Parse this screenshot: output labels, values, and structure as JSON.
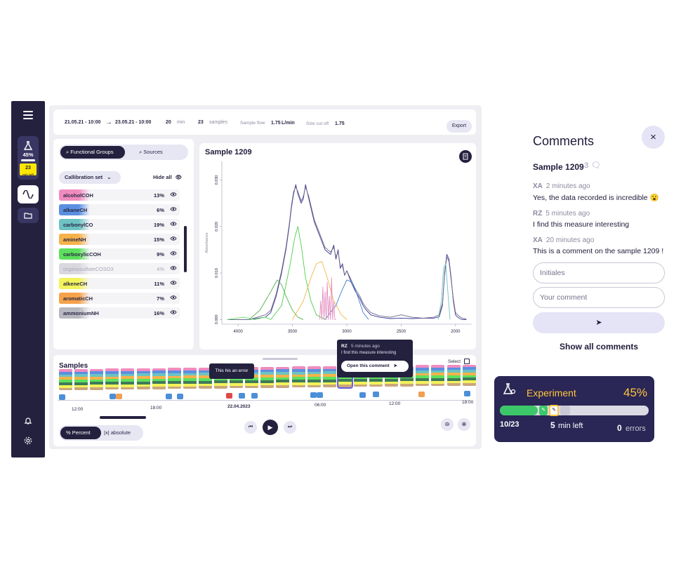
{
  "sidebar": {
    "menu_icon": "hamburger-icon",
    "experiment_percent": "45%",
    "mini_badge": "23",
    "mini_sub": "min left",
    "colors": {
      "bg": "#24213f",
      "accent": "#ffe600"
    }
  },
  "topbar": {
    "date_from": "21.05.21 - 10:00",
    "date_to": "23.05.21 - 10:00",
    "duration_value": "20",
    "duration_unit": "min",
    "samples_value": "23",
    "samples_label": "samples",
    "flow_label": "Sample flow",
    "flow_value": "1.75",
    "flow_unit": "L/min",
    "cutoff_label": "Size cut off",
    "cutoff_value": "1.75",
    "export_label": "Export"
  },
  "groups_panel": {
    "tab_functional": "Functional Groups",
    "tab_sources": "Sources",
    "calibration_label": "Callibration set",
    "hide_all_label": "Hide all",
    "items": [
      {
        "label": "alcoholCOH",
        "percent": "13%",
        "color": "#f08bbf"
      },
      {
        "label": "alkaneCH",
        "percent": "6%",
        "color": "#5b8fe0"
      },
      {
        "label": "carbonylCO",
        "percent": "19%",
        "color": "#6cc3c2"
      },
      {
        "label": "amineNH",
        "percent": "15%",
        "color": "#f6b24a"
      },
      {
        "label": "carboxylicCOH",
        "percent": "9%",
        "color": "#5de05d"
      },
      {
        "label": "organosulfateCOSO3",
        "percent": "4%",
        "color": "#d8d8de"
      },
      {
        "label": "alkeneCH",
        "percent": "11%",
        "color": "#f3f35a"
      },
      {
        "label": "aromaticCH",
        "percent": "7%",
        "color": "#f5a24a"
      },
      {
        "label": "ammoniumNH",
        "percent": "16%",
        "color": "#b8b8c0"
      }
    ]
  },
  "spectrum": {
    "title": "Sample 1209",
    "ylabel": "Absorbance"
  },
  "chart_data": {
    "type": "line",
    "title": "Sample 1209",
    "xlabel": "",
    "ylabel": "Absorbance",
    "x_ticks": [
      "4000",
      "3500",
      "3000",
      "2500",
      "2000"
    ],
    "y_ticks": [
      "0.000",
      "0.010",
      "0.020",
      "0.030"
    ],
    "xlim": [
      4150,
      1850
    ],
    "ylim": [
      -0.001,
      0.034
    ],
    "series": [
      {
        "color": "#3b3a8f",
        "x": [
          4100,
          3900,
          3750,
          3700,
          3650,
          3600,
          3560,
          3530,
          3510,
          3490,
          3470,
          3450,
          3420,
          3400,
          3380,
          3350,
          3300,
          3250,
          3200,
          3150,
          3120,
          3100,
          3080,
          3060,
          3040,
          3020,
          3000,
          2960,
          2920,
          2880,
          2850,
          2820,
          2780,
          2700,
          2600,
          2500,
          2400,
          2300,
          2200,
          2150,
          2120,
          2100,
          2080,
          2060,
          2040,
          2020,
          2000,
          1980,
          1960,
          1940,
          1920,
          1900
        ],
        "y": [
          0.0,
          0.0,
          0.0005,
          0.0015,
          0.005,
          0.01,
          0.015,
          0.02,
          0.024,
          0.027,
          0.029,
          0.027,
          0.025,
          0.026,
          0.029,
          0.026,
          0.021,
          0.018,
          0.015,
          0.014,
          0.016,
          0.013,
          0.015,
          0.011,
          0.012,
          0.0095,
          0.0105,
          0.008,
          0.006,
          0.0045,
          0.003,
          0.002,
          0.001,
          0.0005,
          0.0002,
          0.0003,
          0.0002,
          0.0003,
          0.0003,
          0.0006,
          0.003,
          0.01,
          0.014,
          0.013,
          0.009,
          0.004,
          0.001,
          0.0005,
          0.0002,
          0.0,
          0.0,
          0.0
        ]
      },
      {
        "color": "#6e6a8c",
        "x": [
          4100,
          3900,
          3750,
          3700,
          3650,
          3600,
          3560,
          3530,
          3510,
          3490,
          3470,
          3450,
          3420,
          3400,
          3380,
          3350,
          3300,
          3250,
          3200,
          3150,
          3120,
          3100,
          3080,
          3060,
          3040,
          3020,
          3000,
          2960,
          2920,
          2880,
          2850,
          2820,
          2780,
          2700,
          2600,
          2500,
          2400,
          2300,
          2200,
          2150,
          2120,
          2100,
          2080,
          2060,
          2040,
          2020,
          2000,
          1980,
          1960,
          1940,
          1920,
          1900
        ],
        "y": [
          0.0,
          0.0,
          0.001,
          0.002,
          0.0055,
          0.0105,
          0.0155,
          0.0205,
          0.0245,
          0.0275,
          0.0285,
          0.0275,
          0.0255,
          0.0265,
          0.0285,
          0.0265,
          0.0215,
          0.0185,
          0.0155,
          0.0145,
          0.0155,
          0.0135,
          0.0145,
          0.0115,
          0.0115,
          0.0095,
          0.0105,
          0.0085,
          0.0065,
          0.005,
          0.0035,
          0.0025,
          0.0015,
          0.0008,
          0.0005,
          0.001,
          0.0005,
          0.0003,
          0.0005,
          0.001,
          0.0035,
          0.0095,
          0.0135,
          0.0125,
          0.0085,
          0.0045,
          0.0015,
          0.001,
          0.0006,
          0.0003,
          0.0002,
          0.0001
        ]
      },
      {
        "color": "#4ad04a",
        "x": [
          3700,
          3600,
          3520,
          3480,
          3450,
          3420,
          3380,
          3330,
          3280,
          3200
        ],
        "y": [
          0.0,
          0.003,
          0.012,
          0.0175,
          0.02,
          0.016,
          0.009,
          0.004,
          0.001,
          0.0
        ]
      },
      {
        "color": "#56b24f",
        "x": [
          3900,
          3800,
          3700,
          3640,
          3600,
          3560,
          3500,
          3450,
          3400
        ],
        "y": [
          0.0,
          0.002,
          0.006,
          0.0085,
          0.0075,
          0.005,
          0.002,
          0.0005,
          0.0
        ]
      },
      {
        "color": "#f2b94a",
        "x": [
          3500,
          3400,
          3330,
          3280,
          3230,
          3180,
          3120,
          3050,
          3000
        ],
        "y": [
          0.0,
          0.004,
          0.009,
          0.012,
          0.0125,
          0.009,
          0.004,
          0.001,
          0.0
        ]
      },
      {
        "color": "#3f7fd0",
        "x": [
          3200,
          3100,
          3050,
          3000,
          2950,
          2900,
          2850,
          2800
        ],
        "y": [
          0.0,
          0.003,
          0.006,
          0.0085,
          0.008,
          0.005,
          0.0015,
          0.0
        ]
      },
      {
        "color": "#e48fc0",
        "x": [
          3250,
          3240,
          3230,
          3220,
          3210,
          3200,
          3190,
          3180,
          3170,
          3160,
          3150,
          3140,
          3130,
          3120,
          3110,
          3100
        ],
        "y": [
          0.0,
          0.004,
          0.0,
          0.007,
          0.0,
          0.006,
          0.0,
          0.008,
          0.0,
          0.005,
          0.0,
          0.009,
          0.0,
          0.004,
          0.0,
          0.0
        ]
      },
      {
        "color": "#6cc3c2",
        "x": [
          2160,
          2130,
          2110,
          2090,
          2070,
          2050
        ],
        "y": [
          0.0,
          0.004,
          0.011,
          0.012,
          0.006,
          0.0
        ]
      },
      {
        "color": "#5de05d",
        "x": [
          4100,
          3950,
          3850,
          3750,
          3700
        ],
        "y": [
          0.0,
          0.0005,
          0.0,
          0.0005,
          0.0
        ]
      }
    ]
  },
  "samples": {
    "title": "Samples",
    "select_label": "Select",
    "error_tooltip": "This his an error",
    "comment_author": "RZ",
    "comment_time": "5 minutes ago",
    "comment_text": "I find this measure interesting",
    "open_comment_label": "Open this comment",
    "time_labels": [
      "12:00",
      "18:00",
      "22.04.2023",
      "06:00",
      "12:00",
      "18:00"
    ],
    "percent_label": "Percent",
    "absolute_label": "absolute"
  },
  "comments": {
    "title": "Comments",
    "sample_title": "Sample 1209",
    "count": "3",
    "items": [
      {
        "initials": "XA",
        "time": "2 minutes ago",
        "text": "Yes, the data recorded is incredible 😮"
      },
      {
        "initials": "RZ",
        "time": "5 minutes ago",
        "text": "I find this measure interesting"
      },
      {
        "initials": "XA",
        "time": "20 minutes ago",
        "text": "This is a comment on the sample 1209 !"
      }
    ],
    "initials_placeholder": "Initiales",
    "comment_placeholder": "Your comment",
    "show_all_label": "Show all comments"
  },
  "experiment": {
    "title": "Experiment",
    "percent": "45%",
    "progress": 0.45,
    "count": "10/23",
    "minutes_value": "5",
    "minutes_label": "min left",
    "errors_value": "0",
    "errors_label": "errors",
    "colors": {
      "bg": "#2a2655",
      "accent": "#ffc53d",
      "progress": "#3cc86a"
    }
  }
}
